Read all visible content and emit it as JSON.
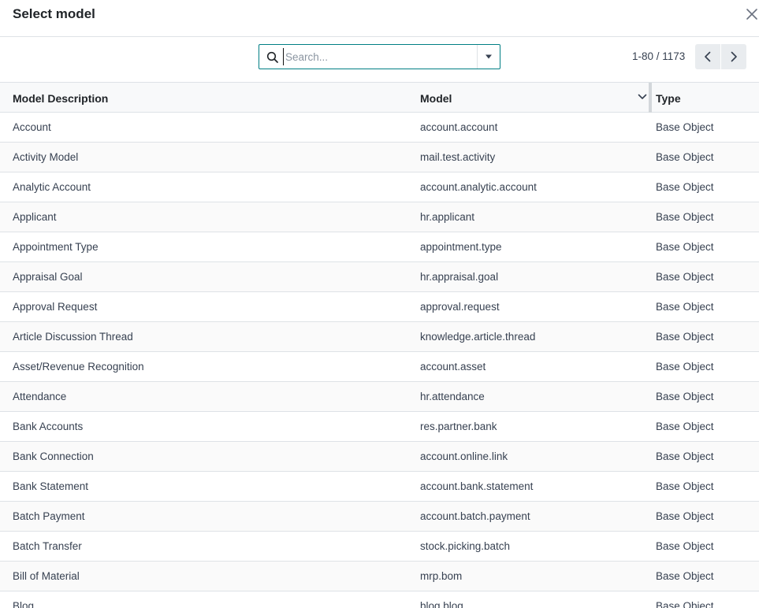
{
  "dialog": {
    "title": "Select model"
  },
  "search": {
    "placeholder": "Search...",
    "value": ""
  },
  "pager": {
    "value": "1-80 / 1173"
  },
  "table": {
    "columns": {
      "description": "Model Description",
      "model": "Model",
      "type": "Type"
    },
    "rows": [
      {
        "description": "Account",
        "model": "account.account",
        "type": "Base Object"
      },
      {
        "description": "Activity Model",
        "model": "mail.test.activity",
        "type": "Base Object"
      },
      {
        "description": "Analytic Account",
        "model": "account.analytic.account",
        "type": "Base Object"
      },
      {
        "description": "Applicant",
        "model": "hr.applicant",
        "type": "Base Object"
      },
      {
        "description": "Appointment Type",
        "model": "appointment.type",
        "type": "Base Object"
      },
      {
        "description": "Appraisal Goal",
        "model": "hr.appraisal.goal",
        "type": "Base Object"
      },
      {
        "description": "Approval Request",
        "model": "approval.request",
        "type": "Base Object"
      },
      {
        "description": "Article Discussion Thread",
        "model": "knowledge.article.thread",
        "type": "Base Object"
      },
      {
        "description": "Asset/Revenue Recognition",
        "model": "account.asset",
        "type": "Base Object"
      },
      {
        "description": "Attendance",
        "model": "hr.attendance",
        "type": "Base Object"
      },
      {
        "description": "Bank Accounts",
        "model": "res.partner.bank",
        "type": "Base Object"
      },
      {
        "description": "Bank Connection",
        "model": "account.online.link",
        "type": "Base Object"
      },
      {
        "description": "Bank Statement",
        "model": "account.bank.statement",
        "type": "Base Object"
      },
      {
        "description": "Batch Payment",
        "model": "account.batch.payment",
        "type": "Base Object"
      },
      {
        "description": "Batch Transfer",
        "model": "stock.picking.batch",
        "type": "Base Object"
      },
      {
        "description": "Bill of Material",
        "model": "mrp.bom",
        "type": "Base Object"
      },
      {
        "description": "Blog",
        "model": "blog.blog",
        "type": "Base Object"
      }
    ]
  },
  "colors": {
    "accent": "#017e84",
    "border": "#dee2e6",
    "header_bg": "#f8f9fa",
    "pager_btn_bg": "#e9ecef"
  },
  "icons": {
    "close": "close-icon",
    "search": "search-icon",
    "toggle": "caret-down-icon",
    "prev": "chevron-left-icon",
    "next": "chevron-right-icon",
    "sort": "chevron-down-icon"
  }
}
